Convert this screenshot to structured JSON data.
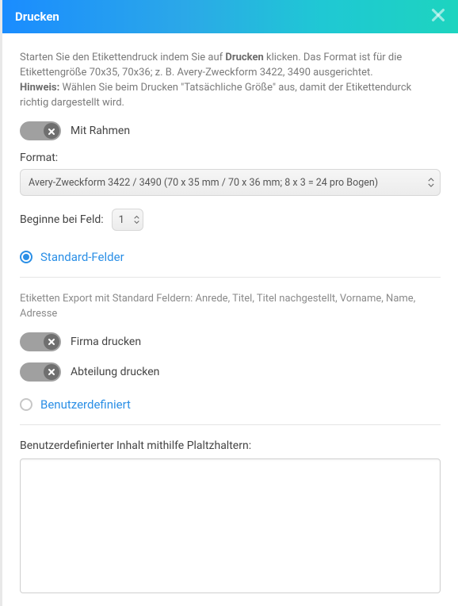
{
  "header": {
    "title": "Drucken"
  },
  "intro": {
    "part1": "Starten Sie den Etikettendruck indem Sie auf ",
    "strong1": "Drucken",
    "part2": " klicken. Das Format ist für die Etikettengröße 70x35, 70x36; z. B. Avery-Zweckform 3422, 3490 ausgerichtet.",
    "hint_label": "Hinweis:",
    "hint_text": " Wählen Sie beim Drucken \"Tatsächliche Größe\" aus, damit der Etikettendurck richtig dargestellt wird."
  },
  "toggles": {
    "mit_rahmen": "Mit Rahmen",
    "firma_drucken": "Firma drucken",
    "abteilung_drucken": "Abteilung drucken"
  },
  "format": {
    "label": "Format:",
    "value": "Avery-Zweckform 3422 / 3490 (70 x 35 mm / 70 x 36 mm; 8 x 3 = 24 pro Bogen)"
  },
  "begin_field": {
    "label": "Beginne bei Feld:",
    "value": "1"
  },
  "radios": {
    "standard": "Standard-Felder",
    "custom": "Benutzerdefiniert"
  },
  "standard_desc": "Etiketten Export mit Standard Feldern: Anrede, Titel, Titel nachgestellt, Vorname, Name, Adresse",
  "custom_section": {
    "label": "Benutzerdefinierter Inhalt mithilfe Plaltzhaltern:"
  }
}
